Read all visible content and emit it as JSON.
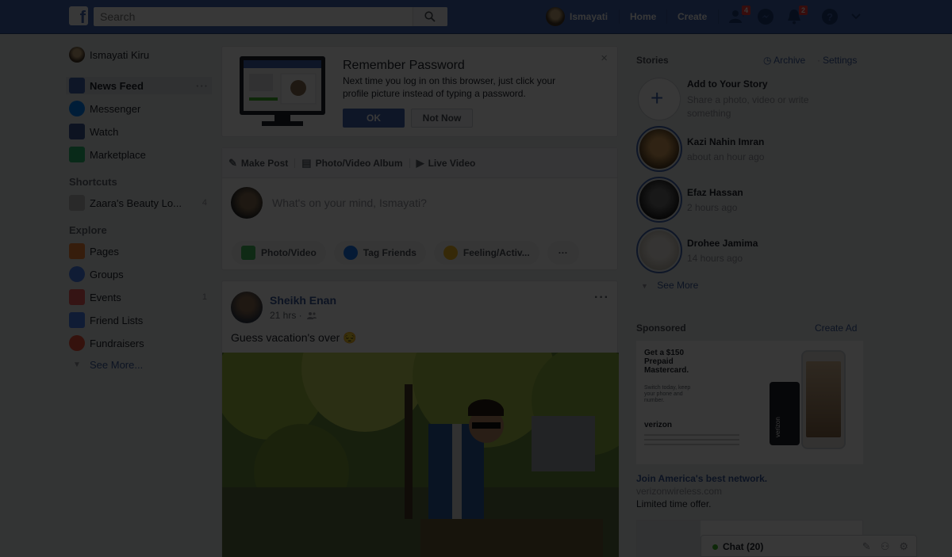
{
  "colors": {
    "brand": "#4267b2",
    "badge": "#fa3e3e",
    "link": "#365899"
  },
  "topbar": {
    "search_placeholder": "Search",
    "user_name": "Ismayati",
    "home_label": "Home",
    "create_label": "Create",
    "friend_requests_badge": "4",
    "notifications_badge": "2",
    "icons": [
      "facebook-logo-icon",
      "search-icon",
      "friend-requests-icon",
      "messenger-icon",
      "notifications-icon",
      "help-icon",
      "chevron-down-icon"
    ]
  },
  "left_nav": {
    "profile_name": "Ismayati Kiru",
    "main": [
      {
        "label": "News Feed",
        "icon": "news-feed-icon"
      },
      {
        "label": "Messenger",
        "icon": "messenger-icon"
      },
      {
        "label": "Watch",
        "icon": "watch-icon"
      },
      {
        "label": "Marketplace",
        "icon": "marketplace-icon"
      }
    ],
    "shortcuts_title": "Shortcuts",
    "shortcut_item": {
      "label": "Zaara's Beauty Lo...",
      "count": "4"
    },
    "explore_title": "Explore",
    "explore": [
      {
        "label": "Pages",
        "icon": "pages-flag-icon",
        "count": ""
      },
      {
        "label": "Groups",
        "icon": "groups-icon",
        "count": ""
      },
      {
        "label": "Events",
        "icon": "events-calendar-icon",
        "count": "1"
      },
      {
        "label": "Friend Lists",
        "icon": "friend-lists-icon",
        "count": ""
      },
      {
        "label": "Fundraisers",
        "icon": "fundraisers-heart-icon",
        "count": ""
      }
    ],
    "see_more": "See More...",
    "more_dots": "···"
  },
  "remember_password": {
    "title": "Remember Password",
    "text": "Next time you log in on this browser, just click your profile picture instead of typing a password.",
    "ok_label": "OK",
    "not_now_label": "Not Now",
    "close": "×"
  },
  "composer": {
    "tabs": [
      {
        "label": "Make Post",
        "icon": "✎"
      },
      {
        "label": "Photo/Video Album",
        "icon": "▤"
      },
      {
        "label": "Live Video",
        "icon": "▶"
      }
    ],
    "placeholder": "What's on your mind, Ismayati?",
    "pills": [
      {
        "label": "Photo/Video"
      },
      {
        "label": "Tag Friends"
      },
      {
        "label": "Feeling/Activ..."
      }
    ],
    "more": "···"
  },
  "post": {
    "author": "Sheikh Enan",
    "time": "21 hrs ·",
    "text": "Guess vacation's over 😔",
    "menu": "···"
  },
  "stories": {
    "title": "Stories",
    "archive_label": "Archive",
    "settings_label": "Settings",
    "separator": "·",
    "add_title": "Add to Your Story",
    "add_subtitle": "Share a photo, video or write something",
    "items": [
      {
        "name": "Kazi Nahin Imran",
        "time": "about an hour ago"
      },
      {
        "name": "Efaz Hassan",
        "time": "2 hours ago"
      },
      {
        "name": "Drohee Jamima",
        "time": "14 hours ago"
      }
    ],
    "see_more": "See More"
  },
  "sponsored": {
    "title": "Sponsored",
    "create_ad": "Create Ad",
    "ad_headline": "Get a $150 Prepaid Mastercard.",
    "ad_small": "Switch today, keep your phone and number.",
    "ad_brand": "verizon",
    "ad_phone_brand": "verizon",
    "headline": "Join America's best network.",
    "domain": "verizonwireless.com",
    "tagline": "Limited time offer."
  },
  "chat": {
    "label": "Chat (20)"
  }
}
